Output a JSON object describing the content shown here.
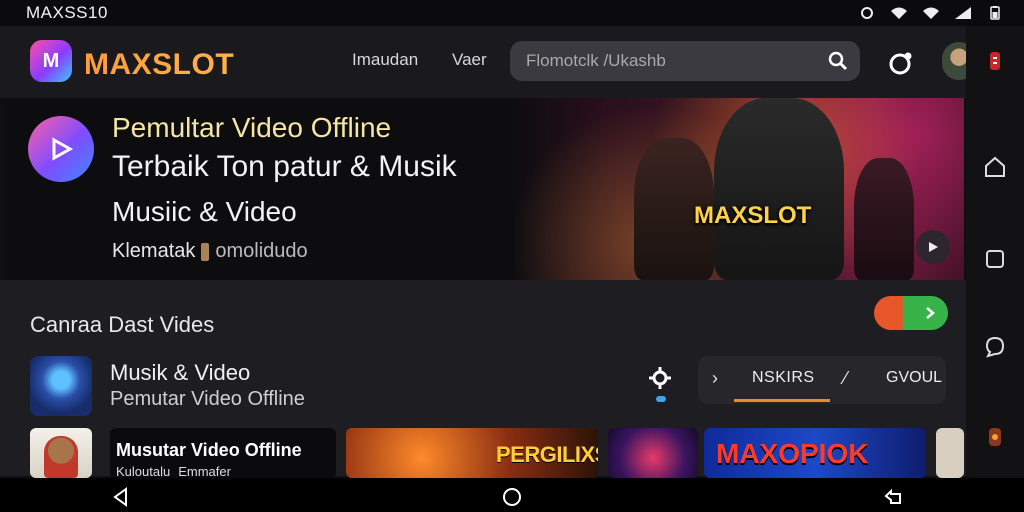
{
  "status_bar": {
    "title": "MAXSS10",
    "icons": [
      "sync-icon",
      "wifi-icon",
      "wifi-icon",
      "signal-icon",
      "battery-icon"
    ]
  },
  "header": {
    "logo_letter": "M",
    "brand": "MAXSLOT",
    "nav": [
      "Imaudan",
      "Vaer"
    ],
    "search_placeholder": "Flomotclk /Ukashb",
    "icons": [
      "search-icon",
      "notification-icon",
      "avatar",
      "menu-icon"
    ]
  },
  "hero": {
    "title1": "Pemultar Video Offline",
    "title2": "Terbaik Ton patur & Musik",
    "title3": "Musiic & Video",
    "sub_label": "Klematak",
    "sub_muted": "omolidudo",
    "art_brand": "MAXSLOT"
  },
  "main": {
    "section_title": "Canraa Dast Vides",
    "row": {
      "title": "Musik & Video",
      "subtitle": "Pemutar Video Offline",
      "chip_label": "NSKIRS",
      "chip_label2": "GVOUL"
    },
    "cards": [
      {
        "title": "Musutar Video Offline",
        "meta1": "Kuloutalu",
        "meta2": "Emmafer"
      },
      {
        "title": "PERGILIXS"
      },
      {
        "title": "MAXOPIOK"
      }
    ]
  },
  "colors": {
    "brand_orange": "#ff9b3b",
    "accent_gold": "#ffd24a",
    "toggle_green": "#37b34a",
    "toggle_orange": "#e8572a"
  }
}
